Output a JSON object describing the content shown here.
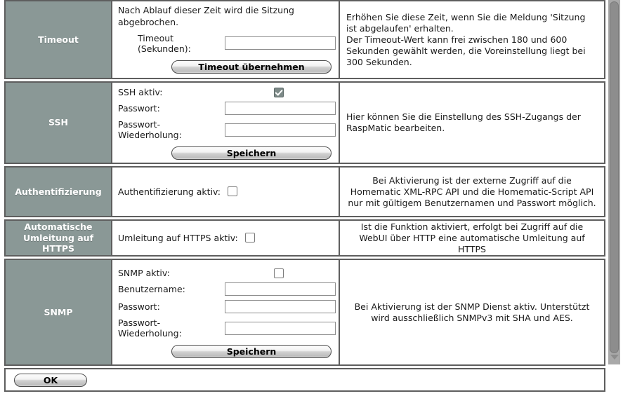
{
  "sections": [
    {
      "key": "timeout",
      "label": "Timeout",
      "intro": "Nach Ablauf dieser Zeit wird die Sitzung abgebrochen.",
      "fields": [
        {
          "type": "text",
          "label": "Timeout (Sekunden):",
          "value": ""
        }
      ],
      "button": "Timeout übernehmen",
      "help": "Erhöhen Sie diese Zeit, wenn Sie die Meldung 'Sitzung ist abgelaufen' erhalten.\nDer Timeout-Wert kann frei zwischen 180 und 600 Sekunden gewählt werden, die Voreinstellung liegt bei 300 Sekunden.",
      "help_align": "left"
    },
    {
      "key": "ssh",
      "label": "SSH",
      "fields": [
        {
          "type": "checkbox",
          "label": "SSH aktiv:",
          "checked": true
        },
        {
          "type": "text",
          "label": "Passwort:",
          "value": ""
        },
        {
          "type": "text",
          "label": "Passwort-Wiederholung:",
          "value": ""
        }
      ],
      "button": "Speichern",
      "help": "Hier können Sie die Einstellung des SSH-Zugangs der RaspMatic bearbeiten.",
      "help_align": "left"
    },
    {
      "key": "authentifizierung",
      "label": "Authentifizierung",
      "fields": [
        {
          "type": "checkbox-inline",
          "label": "Authentifizierung aktiv:",
          "checked": false
        }
      ],
      "help": "Bei Aktivierung ist der externe Zugriff auf die Homematic XML-RPC API und die Homematic-Script API nur mit gültigem Benutzernamen und Passwort möglich.",
      "help_align": "center"
    },
    {
      "key": "https",
      "label": "Automatische Umleitung auf HTTPS",
      "fields": [
        {
          "type": "checkbox-inline",
          "label": "Umleitung auf HTTPS aktiv:",
          "checked": false
        }
      ],
      "help": "Ist die Funktion aktiviert, erfolgt bei Zugriff auf die WebUI über HTTP eine automatische Umleitung auf HTTPS",
      "help_align": "center"
    },
    {
      "key": "snmp",
      "label": "SNMP",
      "fields": [
        {
          "type": "checkbox",
          "label": "SNMP aktiv:",
          "checked": false
        },
        {
          "type": "text",
          "label": "Benutzername:",
          "value": ""
        },
        {
          "type": "text",
          "label": "Passwort:",
          "value": ""
        },
        {
          "type": "text",
          "label": "Passwort-Wiederholung:",
          "value": ""
        }
      ],
      "button": "Speichern",
      "help": "Bei Aktivierung ist der SNMP Dienst aktiv. Unterstützt wird ausschließlich SNMPv3 mit SHA und AES.",
      "help_align": "center"
    }
  ],
  "footer": {
    "ok_label": "OK"
  },
  "scrollbar": {
    "down_arrow_icon": "chevron-down-icon"
  },
  "colors": {
    "label_bg": "#8a9896",
    "border": "#5e5e5e",
    "checkbox_checked_bg": "#7d8a88",
    "scrollbar_track": "#a9a9a9",
    "scrollbar_thumb": "#8d8d8d"
  }
}
